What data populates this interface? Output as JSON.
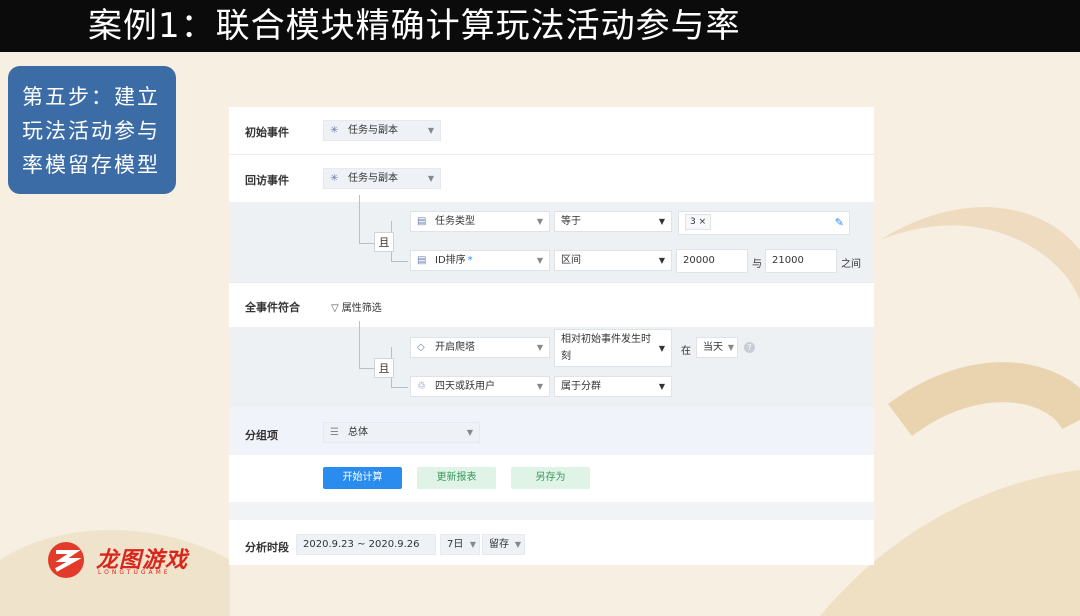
{
  "slide": {
    "title": "案例1：联合模块精确计算玩法活动参与率",
    "step_lines": [
      "第五步：建立",
      "玩法活动参与",
      "率模留存模型"
    ],
    "logo_text": "龙图游戏",
    "logo_sub": "LONGTUGAME"
  },
  "colors": {
    "title_bg": "#0b0b0b",
    "step_bg": "#3b6ca6",
    "primary": "#2b8cf0",
    "ghost": "#dff3e6"
  },
  "form": {
    "initial_event": {
      "label": "初始事件",
      "value": "任务与副本",
      "icon": "click-icon"
    },
    "return_event": {
      "label": "回访事件",
      "value": "任务与副本",
      "icon": "click-icon",
      "logic": "且",
      "conditions": [
        {
          "field": "任务类型",
          "operator": "等于",
          "tag": "3 ×",
          "icon": "property-icon"
        },
        {
          "field": "ID排序",
          "required_mark": "*",
          "operator": "区间",
          "from": "20000",
          "and_text": "与",
          "to": "21000",
          "suffix": "之间",
          "icon": "property-icon"
        }
      ]
    },
    "all_events": {
      "label": "全事件符合",
      "filter_label": "属性筛选",
      "logic": "且",
      "conditions": [
        {
          "field": "开启爬塔",
          "operator_line1": "相对初始事件发生时",
          "operator_line2": "刻",
          "at_text": "在",
          "time_value": "当天",
          "icon": "tag-icon"
        },
        {
          "field": "四天或跃用户",
          "operator": "属于分群",
          "icon": "users-icon"
        }
      ]
    },
    "group": {
      "label": "分组项",
      "value": "总体"
    },
    "buttons": {
      "start": "开始计算",
      "update": "更新报表",
      "save_as": "另存为"
    },
    "period": {
      "label": "分析时段",
      "range": "2020.9.23 ~ 2020.9.26",
      "window": "7日",
      "type": "留存"
    }
  }
}
